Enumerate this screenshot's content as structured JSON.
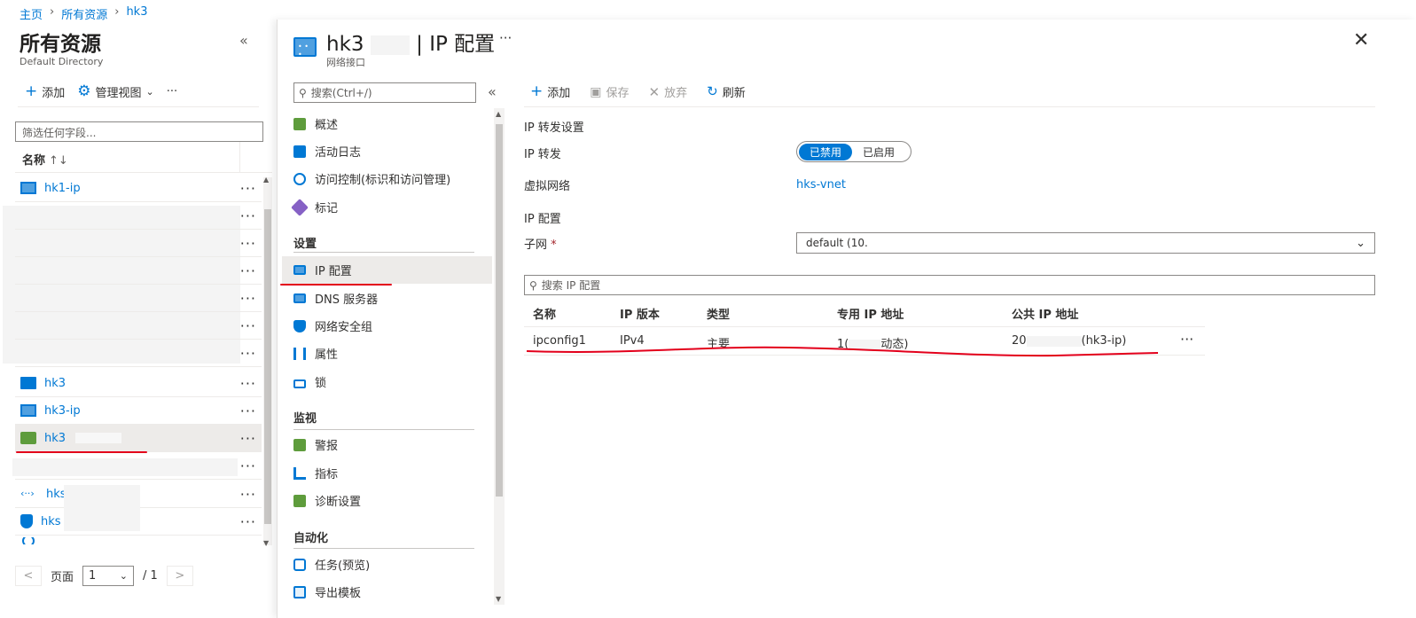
{
  "breadcrumb": {
    "items": [
      "主页",
      "所有资源",
      "hk3"
    ]
  },
  "left_panel": {
    "title": "所有资源",
    "subtitle": "Default Directory",
    "collapse_glyph": "«",
    "toolbar": {
      "add_label": "添加",
      "manage_view_label": "管理视图",
      "more_label": "···"
    },
    "filter_placeholder": "筛选任何字段...",
    "column_name": "名称",
    "sort_glyph": "↑↓",
    "rows": [
      {
        "name": "hk1-ip",
        "icon": "public-ip-icon"
      },
      {
        "name": "",
        "icon": ""
      },
      {
        "name": "",
        "icon": ""
      },
      {
        "name": "",
        "icon": ""
      },
      {
        "name": "",
        "icon": ""
      },
      {
        "name": "",
        "icon": ""
      },
      {
        "name": "",
        "icon": ""
      },
      {
        "name": "hk3",
        "icon": "virtual-machine-icon"
      },
      {
        "name": "hk3-ip",
        "icon": "public-ip-icon"
      },
      {
        "name": "hk3",
        "icon": "network-interface-icon"
      },
      {
        "name": "",
        "icon": ""
      },
      {
        "name": "hks-",
        "icon": "virtual-network-icon"
      },
      {
        "name": "hks",
        "icon": "network-security-group-icon"
      }
    ],
    "pager": {
      "prev": "<",
      "label": "页面",
      "page": "1",
      "of": "/ 1",
      "next": ">"
    }
  },
  "blade": {
    "title": "hk3",
    "title_suffix": "| IP 配置",
    "subtitle": "网络接口",
    "more_label": "···",
    "close_label": "✕",
    "search_placeholder": "搜索(Ctrl+/)",
    "collapse_glyph": "«",
    "menu": [
      {
        "label": "概述",
        "icon": "overview-icon"
      },
      {
        "label": "活动日志",
        "icon": "activity-log-icon"
      },
      {
        "label": "访问控制(标识和访问管理)",
        "icon": "access-control-icon"
      },
      {
        "label": "标记",
        "icon": "tag-icon"
      }
    ],
    "section_settings": "设置",
    "settings_items": [
      {
        "label": "IP 配置",
        "icon": "ip-config-icon"
      },
      {
        "label": "DNS 服务器",
        "icon": "dns-icon"
      },
      {
        "label": "网络安全组",
        "icon": "nsg-icon"
      },
      {
        "label": "属性",
        "icon": "properties-icon"
      },
      {
        "label": "锁",
        "icon": "lock-icon"
      }
    ],
    "section_monitor": "监视",
    "monitor_items": [
      {
        "label": "警报",
        "icon": "alert-icon"
      },
      {
        "label": "指标",
        "icon": "metrics-icon"
      },
      {
        "label": "诊断设置",
        "icon": "diagnostics-icon"
      }
    ],
    "section_automation": "自动化",
    "automation_items": [
      {
        "label": "任务(预览)",
        "icon": "tasks-icon"
      },
      {
        "label": "导出模板",
        "icon": "export-template-icon"
      }
    ]
  },
  "content": {
    "toolbar": {
      "add": "添加",
      "save": "保存",
      "discard": "放弃",
      "refresh": "刷新"
    },
    "ip_forwarding_heading": "IP 转发设置",
    "ip_forwarding_label": "IP 转发",
    "toggle_disabled": "已禁用",
    "toggle_enabled": "已启用",
    "vnet_label": "虚拟网络",
    "vnet_value": "hks-vnet",
    "ip_config_heading": "IP 配置",
    "subnet_label": "子网",
    "required_mark": "*",
    "subnet_value": "default (10.",
    "search_ip_placeholder": "搜索 IP 配置",
    "table": {
      "headers": [
        "名称",
        "IP 版本",
        "类型",
        "专用 IP 地址",
        "公共 IP 地址"
      ],
      "rows": [
        {
          "name": "ipconfig1",
          "version": "IPv4",
          "type": "主要",
          "private_ip": "1(",
          "private_ip_suffix": "动态)",
          "public_ip": "20",
          "public_ip_suffix": "(hk3-ip)",
          "more": "···"
        }
      ]
    }
  },
  "colors": {
    "accent": "#0078d4",
    "annotation_red": "#e3001b"
  }
}
